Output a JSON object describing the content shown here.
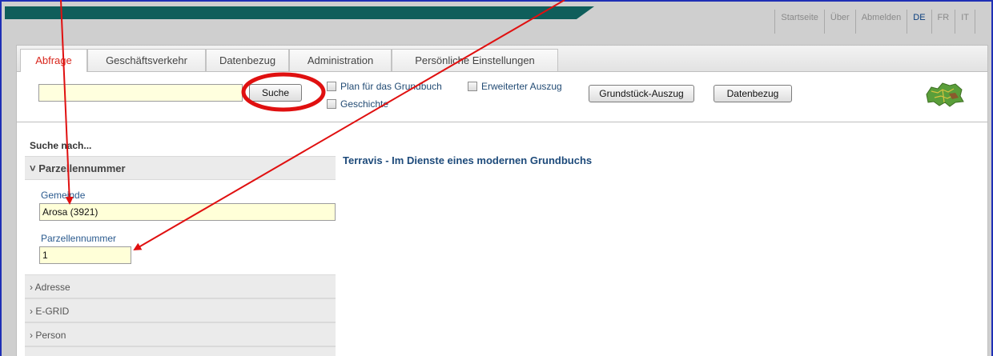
{
  "top_nav": [
    "Startseite",
    "Über",
    "Abmelden",
    "DE",
    "FR",
    "IT"
  ],
  "tabs": [
    "Abfrage",
    "Geschäftsverkehr",
    "Datenbezug",
    "Administration",
    "Persönliche Einstellungen"
  ],
  "toolbar": {
    "search_value": "",
    "search_button": "Suche",
    "checkbox_plan": "Plan für das Grundbuch",
    "checkbox_extended": "Erweiterter Auszug",
    "checkbox_history": "Geschichte",
    "button_extract": "Grundstück-Auszug",
    "button_data": "Datenbezug"
  },
  "sidebar": {
    "title": "Suche nach...",
    "section_open": "Parzellennummer",
    "field_gemeinde_label": "Gemeinde",
    "field_gemeinde_value": "Arosa (3921)",
    "field_parcel_label": "Parzellennummer",
    "field_parcel_value": "1",
    "sections": [
      "Adresse",
      "E-GRID",
      "Person"
    ]
  },
  "content": {
    "title": "Terravis - Im Dienste eines modernen Grundbuchs"
  },
  "colors": {
    "annotation_red": "#e01010",
    "brand_teal": "#0f5e5b",
    "active_tab": "#d9261c"
  },
  "icons": [
    "switzerland-map-icon",
    "chevron-down-icon",
    "chevron-right-icon"
  ]
}
